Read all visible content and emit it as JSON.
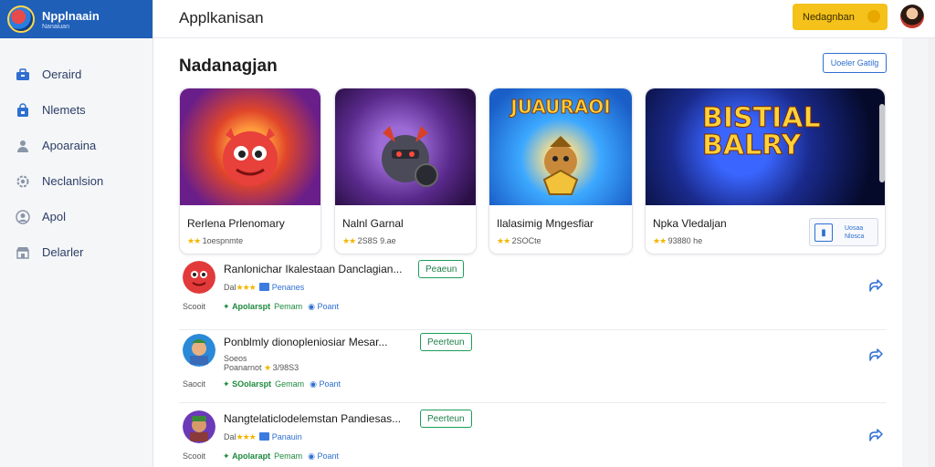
{
  "brand": {
    "title": "Npplnaain",
    "subtitle": "Nanaiuan"
  },
  "sidebar": {
    "items": [
      {
        "label": "Oeraird",
        "icon": "briefcase-icon"
      },
      {
        "label": "Nlemets",
        "icon": "bag-icon"
      },
      {
        "label": "Apoaraina",
        "icon": "person-icon"
      },
      {
        "label": "Neclanlsion",
        "icon": "gear-icon"
      },
      {
        "label": "Apol",
        "icon": "user-circle-icon"
      },
      {
        "label": "Delarler",
        "icon": "store-icon"
      }
    ]
  },
  "header": {
    "title": "Applkanisan",
    "cta_label": "Nedagnban",
    "cta_icon": "emoji-icon"
  },
  "section": {
    "title": "Nadanagjan",
    "link_label": "Uoeler Gatilg"
  },
  "cards": [
    {
      "title": "Rerlena Prlenomary",
      "meta": "1oespnmte",
      "stars": "★★",
      "art": "red-creature"
    },
    {
      "title": "Nalnl Garnal",
      "meta": "2S8S 9.ae",
      "stars": "★★",
      "art": "armored-knight"
    },
    {
      "title": "Ilalasimig Mngesfiar",
      "meta": "2SOCte",
      "stars": "★★",
      "art_text": "JUAURAOI"
    },
    {
      "title": "Npka Vledaljan",
      "meta": "93880 he",
      "stars": "★★",
      "art_text_1": "BISTIAL",
      "art_text_2": "BALRY",
      "action_line1": "Uosaa",
      "action_line2": "Nlosca"
    }
  ],
  "list": [
    {
      "title": "Ranlonichar Ikalestaan Danclagian...",
      "badge": "Peaeun",
      "sub_prefix": "Dal",
      "sub_stars": "★★★",
      "sub_text": "Penanes",
      "tag": "Scooit",
      "foot_green": "Apolarspt",
      "foot_green_2": "Pemam",
      "foot_blue": "Poant"
    },
    {
      "title": "Ponblmly dionopleniosiar Mesar...",
      "badge": "Peerteun",
      "sub_prefix": "Poanarnot",
      "sub_stars": "★",
      "sub_text": "3/98S3",
      "sub_extra": "Soeos",
      "tag": "Saocit",
      "foot_green": "SOolarspt",
      "foot_green_2": "Gemam",
      "foot_blue": "Poant"
    },
    {
      "title": "Nangtelaticlodelemstan Pandiesas...",
      "badge": "Peerteun",
      "sub_prefix": "Dal",
      "sub_stars": "★★★",
      "sub_text": "Panauin",
      "tag": "Scooit",
      "foot_green": "Apolarapt",
      "foot_green_2": "Pemam",
      "foot_blue": "Poant"
    }
  ],
  "colors": {
    "brand": "#1f5fb8",
    "cta": "#f4c21a",
    "link": "#2e6fd1",
    "badge": "#1e9d5a"
  }
}
